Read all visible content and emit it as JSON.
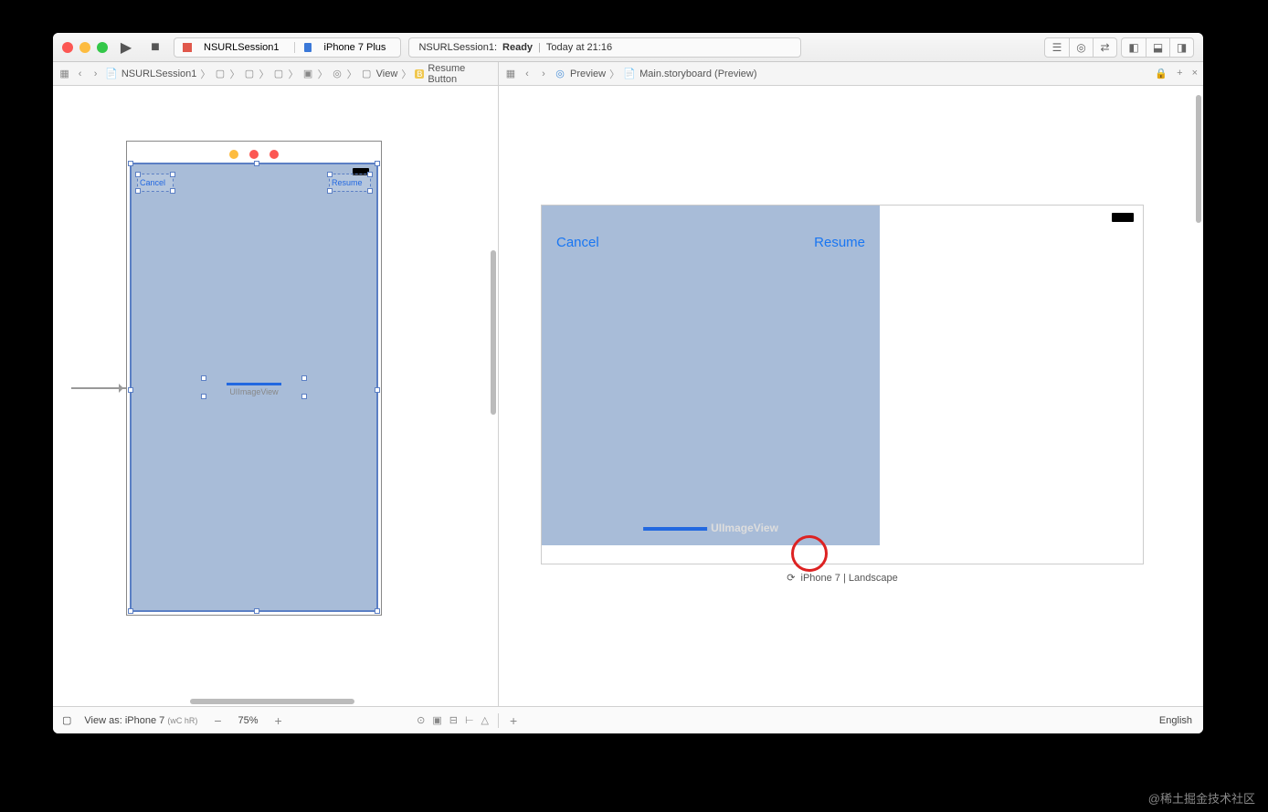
{
  "toolbar": {
    "scheme_project": "NSURLSession1",
    "scheme_device": "iPhone 7 Plus",
    "status_project": "NSURLSession1:",
    "status_state": "Ready",
    "status_time": "Today at 21:16"
  },
  "jumpbar_left": {
    "items": [
      "NSURLSession1",
      "",
      "",
      "",
      "",
      "",
      "View",
      "Resume Button"
    ],
    "last_prefix": "B"
  },
  "jumpbar_right": {
    "preview": "Preview",
    "file": "Main.storyboard (Preview)"
  },
  "canvas": {
    "cancel_label": "Cancel",
    "resume_label": "Resume",
    "uiimage_label": "UIImageView"
  },
  "preview": {
    "cancel_label": "Cancel",
    "resume_label": "Resume",
    "uiimage_label": "UIImageView",
    "device_label": "iPhone 7 | Landscape"
  },
  "footer": {
    "view_as": "View as: iPhone 7",
    "size_class": "(wC hR)",
    "zoom": "75%",
    "language": "English"
  },
  "watermark": "@稀土掘金技术社区"
}
